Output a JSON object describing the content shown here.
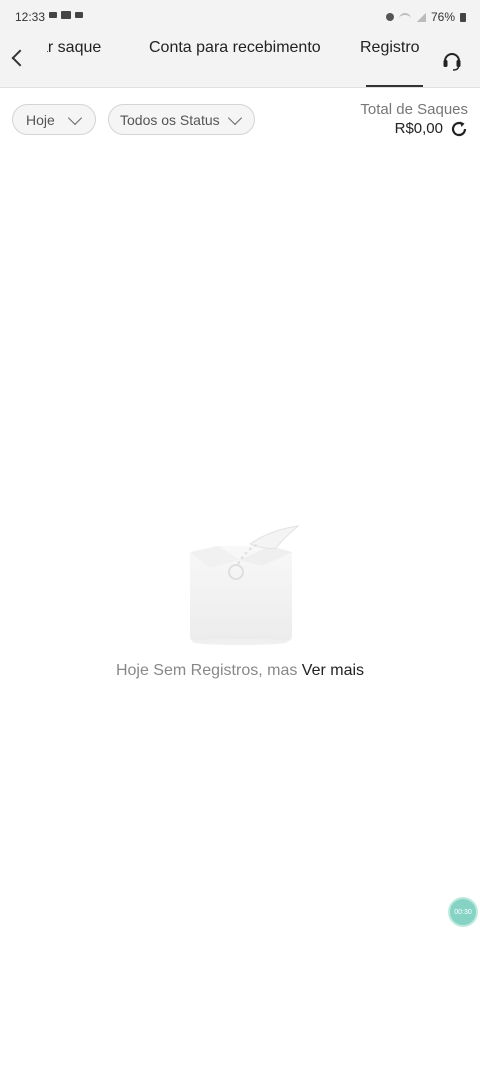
{
  "status_bar": {
    "time": "12:33",
    "battery": "76%"
  },
  "nav": {
    "tabs": [
      {
        "label": "ar saque"
      },
      {
        "label": "Conta para recebimento"
      },
      {
        "label": "Registro"
      }
    ],
    "active_tab": "Registro"
  },
  "filters": {
    "date": {
      "value": "Hoje"
    },
    "status": {
      "value": "Todos os Status"
    }
  },
  "summary": {
    "label": "Total de Saques",
    "value": "R$0,00"
  },
  "empty_state": {
    "message": "Hoje Sem Registros, mas",
    "link": "Ver mais"
  },
  "timer": {
    "value": "00:30"
  },
  "colors": {
    "accent": "#333333",
    "muted_text": "#888888",
    "timer_badge": "#86d3c4"
  },
  "icons": {
    "back": "chevron-left-icon",
    "support": "headset-icon",
    "refresh": "refresh-icon",
    "dropdown": "chevron-down-icon"
  }
}
